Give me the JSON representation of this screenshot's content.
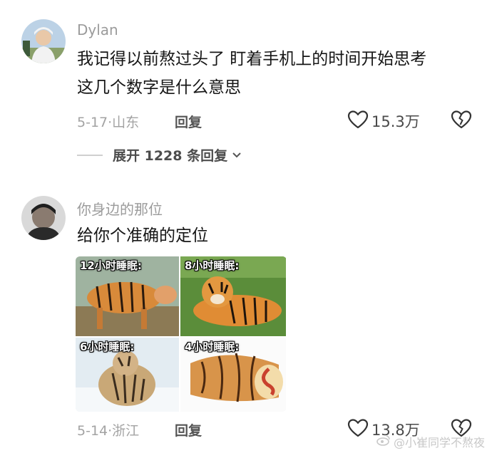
{
  "comments": [
    {
      "username": "Dylan",
      "text_lines": [
        "我记得以前熬过头了 盯着手机上的时间开始思考",
        "这几个数字是什么意思"
      ],
      "date": "5-17",
      "location": "山东",
      "reply_label": "回复",
      "likes": "15.3万",
      "expand_label": "展开 1228 条回复"
    },
    {
      "username": "你身边的那位",
      "text_lines": [
        "给你个准确的定位"
      ],
      "date": "5-14",
      "location": "浙江",
      "reply_label": "回复",
      "likes": "13.8万",
      "meme": {
        "labels": [
          "12小时睡眠:",
          "8小时睡眠:",
          "6小时睡眠:",
          "4小时睡眠:"
        ]
      }
    }
  ],
  "meta_separator": "·",
  "watermark": "@小崔同学不熬夜",
  "icons": {
    "like": "heart-outline-icon",
    "dislike": "broken-heart-icon",
    "expand": "chevron-down-icon",
    "watermark_logo": "weibo-logo-icon"
  },
  "colors": {
    "text": "#161616",
    "muted": "#9b9b9b",
    "count": "#4a4a4a"
  }
}
